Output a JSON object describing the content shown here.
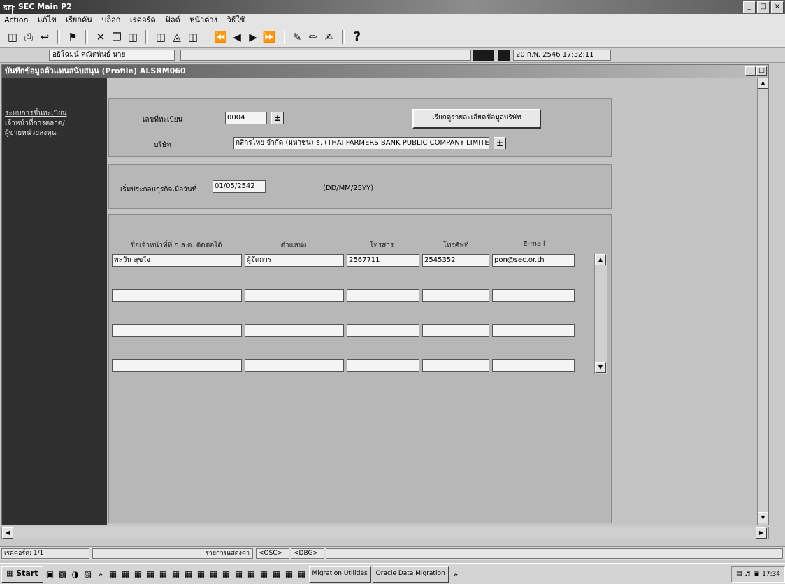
{
  "window": {
    "title": "SEC Main P2",
    "icon_text": "SEC",
    "buttons": [
      "_",
      "□",
      "×"
    ]
  },
  "menu": [
    "Action",
    "แก้ไข",
    "เรียกค้น",
    "บล็อก",
    "เรคอร์ด",
    "ฟิลด์",
    "หน้าต่าง",
    "วิธีใช้"
  ],
  "toolbar_icons": [
    "save-icon",
    "print-icon",
    "exit-icon",
    "clear-icon",
    "cut-icon",
    "copy-icon",
    "paste-icon",
    "insert-record-icon",
    "delete-record-icon",
    "duplicate-icon",
    "first-record-icon",
    "previous-record-icon",
    "next-record-icon",
    "last-record-icon",
    "query-enter-icon",
    "query-execute-icon",
    "query-cancel-icon",
    "help-icon"
  ],
  "help_glyph": "?",
  "status_row": {
    "user": "อธิโฉมน์ คณิตพันธ์ นาย",
    "datetime": "20 ก.พ. 2546 17:32:11"
  },
  "form": {
    "title": "บันทึกข้อมูลตัวแทนสนับสนุน (Profile)   ALSRM060",
    "nav_links": [
      "ระบบการขึ้นทะเบียน",
      "เจ้าหน้าที่การตลาด/",
      "ผู้ขายหน่วยลงทุน"
    ],
    "reg_label": "เลขที่ทะเบียน",
    "reg_value": "0004",
    "company_label": "บริษัท",
    "company_value": "กสิกรไทย จำกัด (มหาชน) ธ. (THAI FARMERS BANK PUBLIC COMPANY LIMITED)",
    "lookup_button": "เรียกดูรายละเอียดข้อมูลบริษัท",
    "start_label": "เริ่มประกอบธุรกิจเมื่อวันที่",
    "start_value": "01/05/2542",
    "date_format": "(DD/MM/25YY)",
    "pm_glyph": "±",
    "headers": [
      "ชื่อเจ้าหน้าที่ที่ ก.ล.ต. ติดต่อได้",
      "ตำแหน่ง",
      "โทรสาร",
      "โทรศัพท์",
      "E-mail"
    ],
    "rows": [
      [
        "พลวัน สุขใจ",
        "ผู้จัดการ",
        "2567711",
        "2545352",
        "pon@sec.or.th"
      ],
      [
        "",
        "",
        "",
        "",
        ""
      ],
      [
        "",
        "",
        "",
        "",
        ""
      ],
      [
        "",
        "",
        "",
        "",
        ""
      ]
    ]
  },
  "bottom_status": {
    "record": "เรคคอร์ด: 1/1",
    "list_values": "รายการแสดงค่า",
    "osc": "<OSC>",
    "dbg": "<DBG>"
  },
  "taskbar": {
    "start": "Start",
    "more": "»",
    "tasks": [
      "Migration Utilities",
      "Oracle Data Migration"
    ],
    "clock": "17:34"
  }
}
